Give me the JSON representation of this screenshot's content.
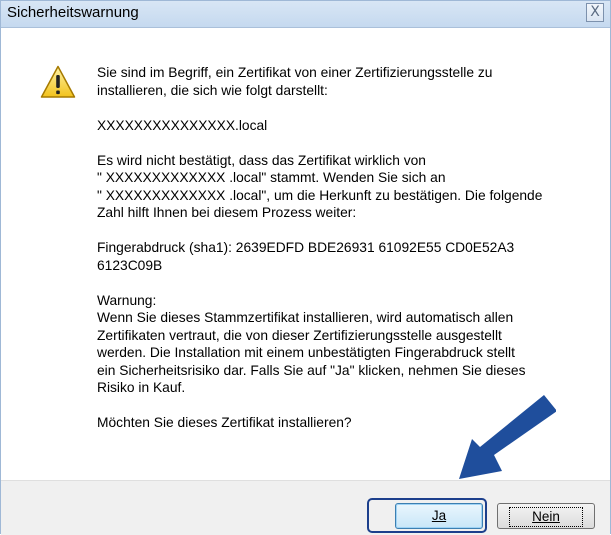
{
  "dialog": {
    "title": "Sicherheitswarnung",
    "close_label": "X",
    "icon": "warning-triangle-icon",
    "paragraphs": [
      "Sie sind im Begriff, ein Zertifikat von einer Zertifizierungsstelle zu\ninstallieren, die sich wie folgt darstellt:",
      "XXXXXXXXXXXXXXX.local",
      "Es wird nicht bestätigt, dass das Zertifikat wirklich von\n\" XXXXXXXXXXXXX .local\" stammt. Wenden Sie sich an\n\" XXXXXXXXXXXXX .local\", um die Herkunft zu bestätigen. Die folgende\nZahl hilft Ihnen bei diesem Prozess weiter:",
      "Fingerabdruck (sha1): 2639EDFD BDE26931 61092E55 CD0E52A3\n6123C09B",
      "Warnung:\nWenn Sie dieses Stammzertifikat installieren, wird automatisch allen\nZertifikaten vertraut, die von dieser Zertifizierungsstelle ausgestellt\nwerden. Die Installation mit einem unbestätigten Fingerabdruck stellt\nein Sicherheitsrisiko dar. Falls Sie auf \"Ja\" klicken, nehmen Sie dieses\nRisiko in Kauf.",
      "Möchten Sie dieses Zertifikat installieren?"
    ]
  },
  "buttons": {
    "yes_label": "Ja",
    "no_label": "Nein"
  },
  "colors": {
    "annotation_arrow": "#1f4e9c",
    "title_bar": "#c5d9ef"
  }
}
